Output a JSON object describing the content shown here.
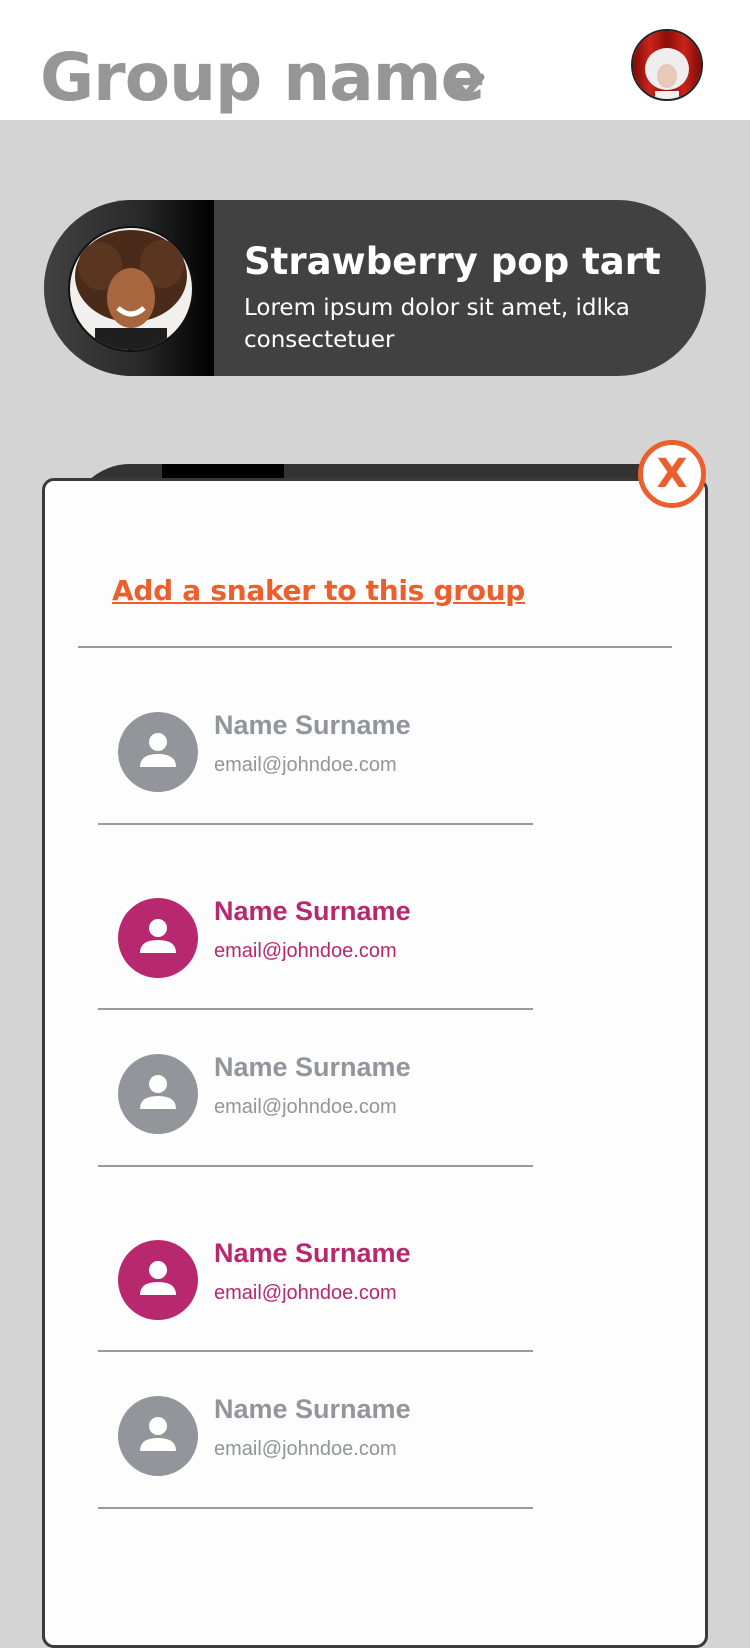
{
  "header": {
    "group_title": "Group name",
    "user_avatar_icon": "user-photo-avatar"
  },
  "group_card": {
    "name": "Strawberry pop tart",
    "description": "Lorem ipsum dolor sit amet, idlka consectetuer"
  },
  "modal": {
    "close_label": "X",
    "add_link": "Add a snaker to this group",
    "people": [
      {
        "name": "Name Surname",
        "email": "email@johndoe.com",
        "state": "unselected"
      },
      {
        "name": "Name Surname",
        "email": "email@johndoe.com",
        "state": "selected"
      },
      {
        "name": "Name Surname",
        "email": "email@johndoe.com",
        "state": "unselected"
      },
      {
        "name": "Name Surname",
        "email": "email@johndoe.com",
        "state": "selected"
      },
      {
        "name": "Name Surname",
        "email": "email@johndoe.com",
        "state": "unselected"
      }
    ]
  },
  "colors": {
    "accent_orange": "#ec5e2c",
    "selected_pink": "#b8286e",
    "unselected_gray": "#929599",
    "card_dark": "#414141",
    "backdrop": "#d4d4d4"
  }
}
